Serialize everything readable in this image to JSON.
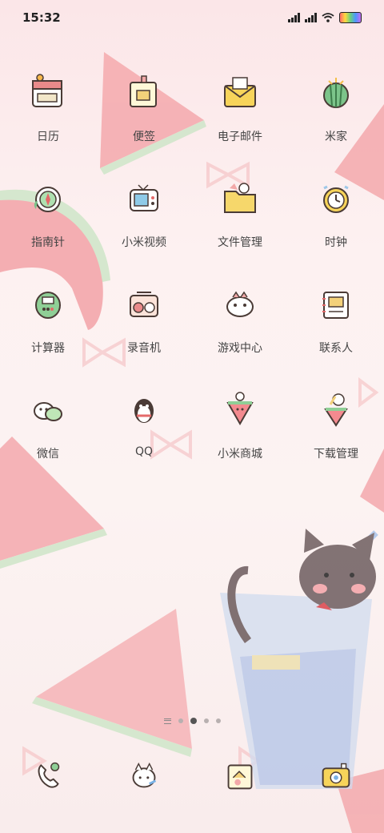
{
  "status_bar": {
    "time": "15:32"
  },
  "apps": [
    {
      "label": "日历",
      "icon": "calendar-icon"
    },
    {
      "label": "便签",
      "icon": "notes-icon"
    },
    {
      "label": "电子邮件",
      "icon": "email-icon"
    },
    {
      "label": "米家",
      "icon": "mijia-icon"
    },
    {
      "label": "指南针",
      "icon": "compass-icon"
    },
    {
      "label": "小米视频",
      "icon": "video-icon"
    },
    {
      "label": "文件管理",
      "icon": "folder-icon"
    },
    {
      "label": "时钟",
      "icon": "clock-icon"
    },
    {
      "label": "计算器",
      "icon": "calculator-icon"
    },
    {
      "label": "录音机",
      "icon": "recorder-icon"
    },
    {
      "label": "游戏中心",
      "icon": "game-center-icon"
    },
    {
      "label": "联系人",
      "icon": "contacts-icon"
    },
    {
      "label": "微信",
      "icon": "wechat-icon"
    },
    {
      "label": "QQ",
      "icon": "qq-icon"
    },
    {
      "label": "小米商城",
      "icon": "mi-store-icon"
    },
    {
      "label": "下载管理",
      "icon": "download-icon"
    }
  ],
  "page_indicator": {
    "pages": 4,
    "active": 1
  },
  "dock": [
    {
      "icon": "phone-icon"
    },
    {
      "icon": "messages-icon"
    },
    {
      "icon": "browser-icon"
    },
    {
      "icon": "camera-icon"
    }
  ]
}
